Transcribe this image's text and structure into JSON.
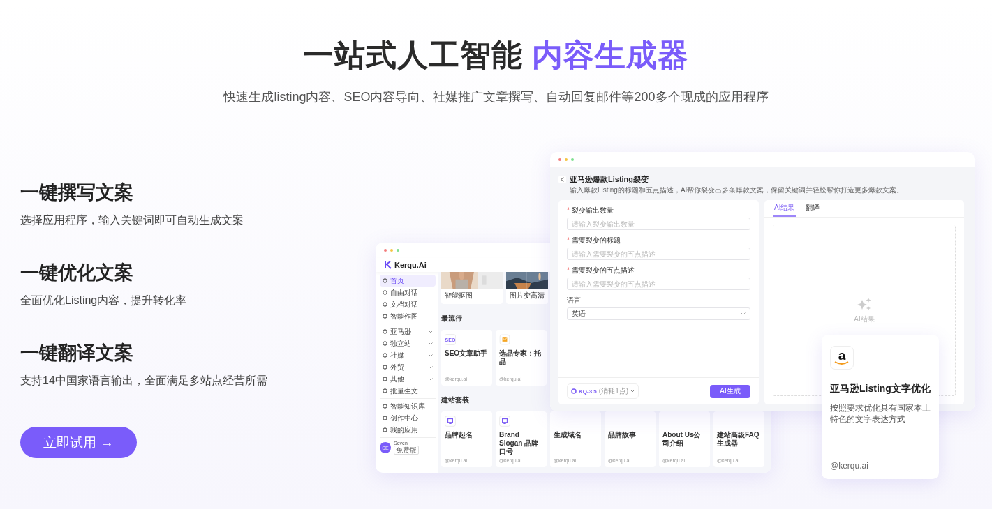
{
  "hero": {
    "title": "一站式人工智能",
    "title_highlight": "内容生成器",
    "subtitle": "快速生成listing内容、SEO内容导向、社媒推广文章撰写、自动回复邮件等200多个现成的应用程序"
  },
  "features": [
    {
      "title": "一键撰写文案",
      "text": "选择应用程序，输入关键词即可自动生成文案"
    },
    {
      "title": "一键优化文案",
      "text": "全面优化Listing内容，提升转化率"
    },
    {
      "title": "一键翻译文案",
      "text": "支持14中国家语言输出，全面满足多站点经营所需"
    }
  ],
  "cta": "立即试用 →",
  "app_window": {
    "logo": "Kerqu.Ai",
    "sidebar": {
      "sections": [
        [
          {
            "label": "首页",
            "selected": true,
            "expandable": false
          },
          {
            "label": "自由对话",
            "selected": false,
            "expandable": false
          },
          {
            "label": "文档对话",
            "selected": false,
            "expandable": false
          },
          {
            "label": "智能作图",
            "selected": false,
            "expandable": false
          }
        ],
        [
          {
            "label": "亚马逊",
            "selected": false,
            "expandable": true
          },
          {
            "label": "独立站",
            "selected": false,
            "expandable": true
          },
          {
            "label": "社媒",
            "selected": false,
            "expandable": true
          },
          {
            "label": "外贸",
            "selected": false,
            "expandable": true
          },
          {
            "label": "其他",
            "selected": false,
            "expandable": true
          },
          {
            "label": "批量生文",
            "selected": false,
            "expandable": false
          }
        ],
        [
          {
            "label": "智能知识库",
            "selected": false,
            "expandable": false
          },
          {
            "label": "创作中心",
            "selected": false,
            "expandable": false
          },
          {
            "label": "我的应用",
            "selected": false,
            "expandable": false
          }
        ]
      ],
      "user": {
        "avatar": "SE",
        "name": "Seven",
        "plan": "免费版"
      }
    },
    "top_cards": [
      {
        "title": "智能抠图",
        "kind": "picture"
      },
      {
        "title": "图片变高清",
        "kind": "picture"
      }
    ],
    "sections": [
      {
        "title": "最流行",
        "cards": [
          {
            "title": "SEO文章助手",
            "kind": "text",
            "icon_text": "SEO",
            "footer": "@kerqu.ai"
          },
          {
            "title": "选品专家：托品",
            "kind": "envelope",
            "footer": "@kerqu.ai"
          }
        ]
      },
      {
        "title": "建站套装",
        "cards": [
          {
            "title": "品牌起名",
            "kind": "monitor",
            "footer": "@kerqu.ai"
          },
          {
            "title": "Brand Slogan 品牌口号",
            "kind": "monitor",
            "footer": "@kerqu.ai"
          },
          {
            "title": "生成域名",
            "kind": "plain",
            "footer": "@kerqu.ai"
          },
          {
            "title": "品牌故事",
            "kind": "plain",
            "footer": "@kerqu.ai"
          },
          {
            "title": "About Us公司介绍",
            "kind": "plain",
            "footer": "@kerqu.ai"
          },
          {
            "title": "建站高级FAQ生成器",
            "kind": "plain",
            "footer": "@kerqu.ai"
          }
        ]
      }
    ]
  },
  "tool_window": {
    "title": "亚马逊爆款Listing裂变",
    "subtitle": "输入爆款Listing的标题和五点描述，AI帮你裂变出多条爆款文案，保留关键词并轻松帮你打造更多爆款文案。",
    "fields": [
      {
        "label": "裂变输出数量",
        "required_mark": "*",
        "kind": "input",
        "placeholder": "请输入裂变输出数量"
      },
      {
        "label": "需要裂变的标题",
        "required_mark": "*",
        "kind": "input",
        "placeholder": "请输入需要裂变的五点描述"
      },
      {
        "label": "需要裂变的五点描述",
        "required_mark": "*",
        "kind": "input",
        "placeholder": "请输入需要裂变的五点描述"
      },
      {
        "label": "语言",
        "kind": "select",
        "value": "英语"
      }
    ],
    "model": "KQ-3.5",
    "model_note": "(消耗1点)",
    "generate_button": "AI生成",
    "tabs": [
      {
        "label": "AI结果",
        "selected": true
      },
      {
        "label": "翻译",
        "selected": false
      }
    ],
    "empty_text": "AI结果"
  },
  "float_card": {
    "logo_text": "a",
    "title": "亚马逊Listing文字优化",
    "text": "按照要求优化具有国家本土特色的文字表达方式",
    "footer": "@kerqu.ai"
  }
}
